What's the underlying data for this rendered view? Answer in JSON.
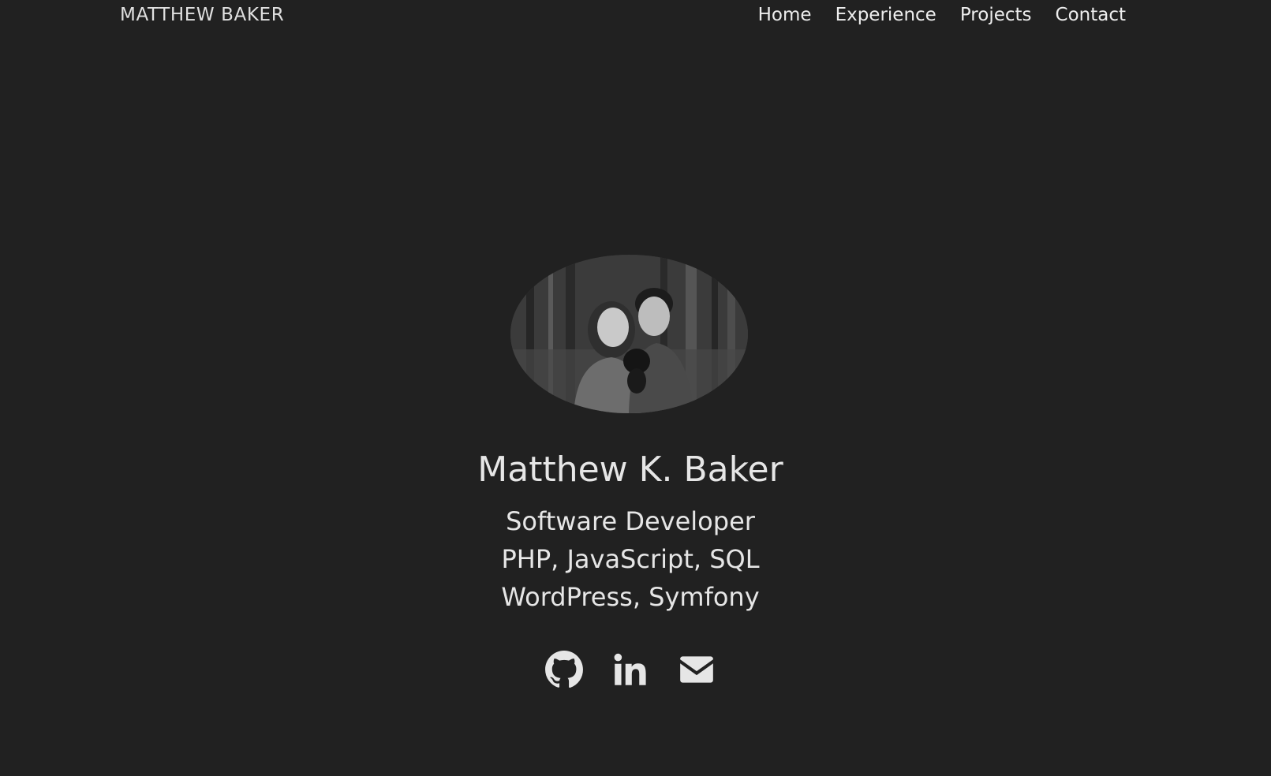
{
  "nav": {
    "brand": "MATTHEW BAKER",
    "links": [
      {
        "label": "Home"
      },
      {
        "label": "Experience"
      },
      {
        "label": "Projects"
      },
      {
        "label": "Contact"
      }
    ]
  },
  "hero": {
    "name": "Matthew K. Baker",
    "lines": [
      "Software Developer",
      "PHP, JavaScript, SQL",
      "WordPress, Symfony"
    ],
    "social_icons": [
      "github-icon",
      "linkedin-icon",
      "envelope-icon"
    ]
  },
  "colors": {
    "background": "#212121",
    "text": "#e6e6e6"
  }
}
